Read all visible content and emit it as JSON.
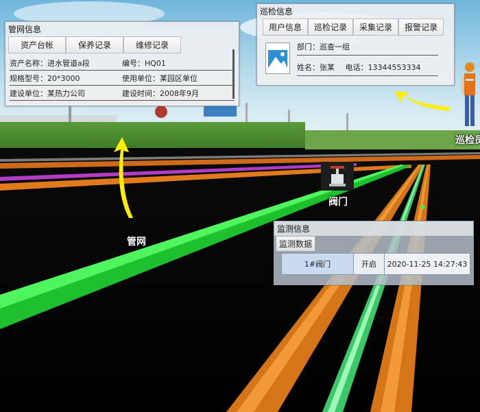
{
  "pipe_panel": {
    "title": "管网信息",
    "tabs": [
      "资产台帐",
      "保养记录",
      "维修记录"
    ],
    "rows": [
      [
        "资产名称：进水管道a段",
        "编号：HQ01"
      ],
      [
        "规格型号：20*3000",
        "使用单位：某园区单位"
      ],
      [
        "建设单位：某热力公司",
        "建设时间：2008年9月"
      ]
    ]
  },
  "patrol_panel": {
    "title": "巡检信息",
    "tabs": [
      "用户信息",
      "巡检记录",
      "采集记录",
      "报警记录"
    ],
    "department": "部门：巡查一组",
    "name": "姓名：张某",
    "phone": "电话：13344553334"
  },
  "monitor_panel": {
    "title": "监测信息",
    "section": "监测数据",
    "row": [
      "1#阀门",
      "开启",
      "2020-11-25 14:27:43"
    ]
  },
  "scene_labels": {
    "pipe_network": "管网",
    "valve": "阀门",
    "patrol": "巡检员"
  },
  "colors": {
    "green_pipe": "#27d83a",
    "orange_pipe": "#e07a1a",
    "light_green_pipe": "#7ef0a0",
    "arrow_yellow": "#ffee00"
  }
}
